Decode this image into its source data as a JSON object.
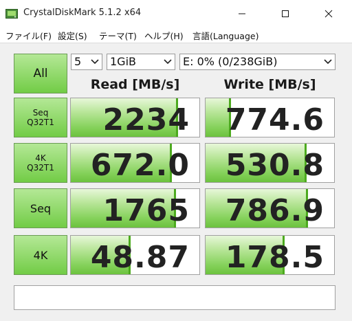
{
  "window": {
    "title": "CrystalDiskMark 5.1.2 x64"
  },
  "menu": [
    "ファイル(F)",
    "設定(S)",
    "テーマ(T)",
    "ヘルプ(H)",
    "言語(Language)"
  ],
  "controls": {
    "all_label": "All",
    "count": "5",
    "size": "1GiB",
    "drive": "E: 0% (0/238GiB)"
  },
  "headers": {
    "read": "Read [MB/s]",
    "write": "Write [MB/s]"
  },
  "rows": [
    {
      "line1": "Seq",
      "line2": "Q32T1",
      "read": "2234",
      "write": "774.6",
      "read_fill": 0.82,
      "write_fill": 0.18
    },
    {
      "line1": "4K",
      "line2": "Q32T1",
      "read": "672.0",
      "write": "530.8",
      "read_fill": 0.77,
      "write_fill": 0.77
    },
    {
      "line1": "Seq",
      "line2": "",
      "read": "1765",
      "write": "786.9",
      "read_fill": 0.8,
      "write_fill": 0.78
    },
    {
      "line1": "4K",
      "line2": "",
      "read": "48.87",
      "write": "178.5",
      "read_fill": 0.45,
      "write_fill": 0.6
    }
  ],
  "status": "",
  "icons": {
    "app": "disk-icon",
    "minimize": "minimize-icon",
    "maximize": "maximize-icon",
    "close": "close-icon",
    "dropdown": "chevron-down-icon"
  },
  "colors": {
    "button_green": "#72cc46",
    "bar_green": "#6cc23e",
    "background": "#f0f0f0"
  }
}
